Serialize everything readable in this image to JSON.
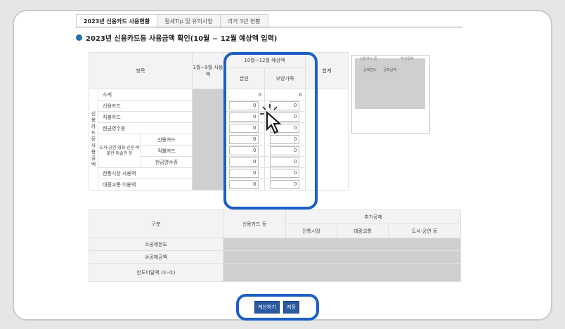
{
  "tabs": [
    "2023년 신용카드 사용현황",
    "절세Tip 및 유의사항",
    "과거 3년 현황"
  ],
  "section_title": "2023년 신용카드등 사용금액 확인(10월 ~ 12월 예상액 입력)",
  "usage_table": {
    "col_item": "항목",
    "col_jan_sep": "1월~9월 사용액",
    "col_oct_dec": "10월~12월 예상액",
    "col_self": "본인",
    "col_dependent": "부양가족",
    "col_total": "합계",
    "group_label": "신용카드등 사용금액",
    "rows": [
      {
        "label": "소계",
        "self": "0",
        "dep": "0",
        "editable": false
      },
      {
        "label": "신용카드",
        "self": "0",
        "dep": "0",
        "editable": true
      },
      {
        "label": "직불카드",
        "self": "0",
        "dep": "0",
        "editable": true
      },
      {
        "label": "현금영수증",
        "self": "0",
        "dep": "0",
        "editable": true
      }
    ],
    "culture_group": "도서·공연·영화·신문·박물관·미술관 등",
    "culture_rows": [
      {
        "label": "신용카드",
        "self": "0",
        "dep": "0"
      },
      {
        "label": "직불카드",
        "self": "0",
        "dep": "0"
      },
      {
        "label": "현금영수증",
        "self": "0",
        "dep": "0"
      }
    ],
    "tail_rows": [
      {
        "label": "전통시장 사용액",
        "self": "0",
        "dep": "0"
      },
      {
        "label": "대중교통 이용액",
        "self": "0",
        "dep": "0"
      }
    ]
  },
  "side_panel": {
    "label_left": "신용카드 등",
    "label_right": "추가공제",
    "legend_self": "공제한도",
    "legend_amount": "공제금액"
  },
  "deduction_table": {
    "col_category": "구분",
    "col_card": "신용카드 등",
    "col_extra": "추가공제",
    "col_market": "전통시장",
    "col_transit": "대중교통",
    "col_culture": "도서·공연 등",
    "rows": [
      "①공제한도",
      "②공제금액",
      "한도미달액 (①-②)"
    ]
  },
  "buttons": {
    "calc": "계산하기",
    "save": "저장"
  }
}
